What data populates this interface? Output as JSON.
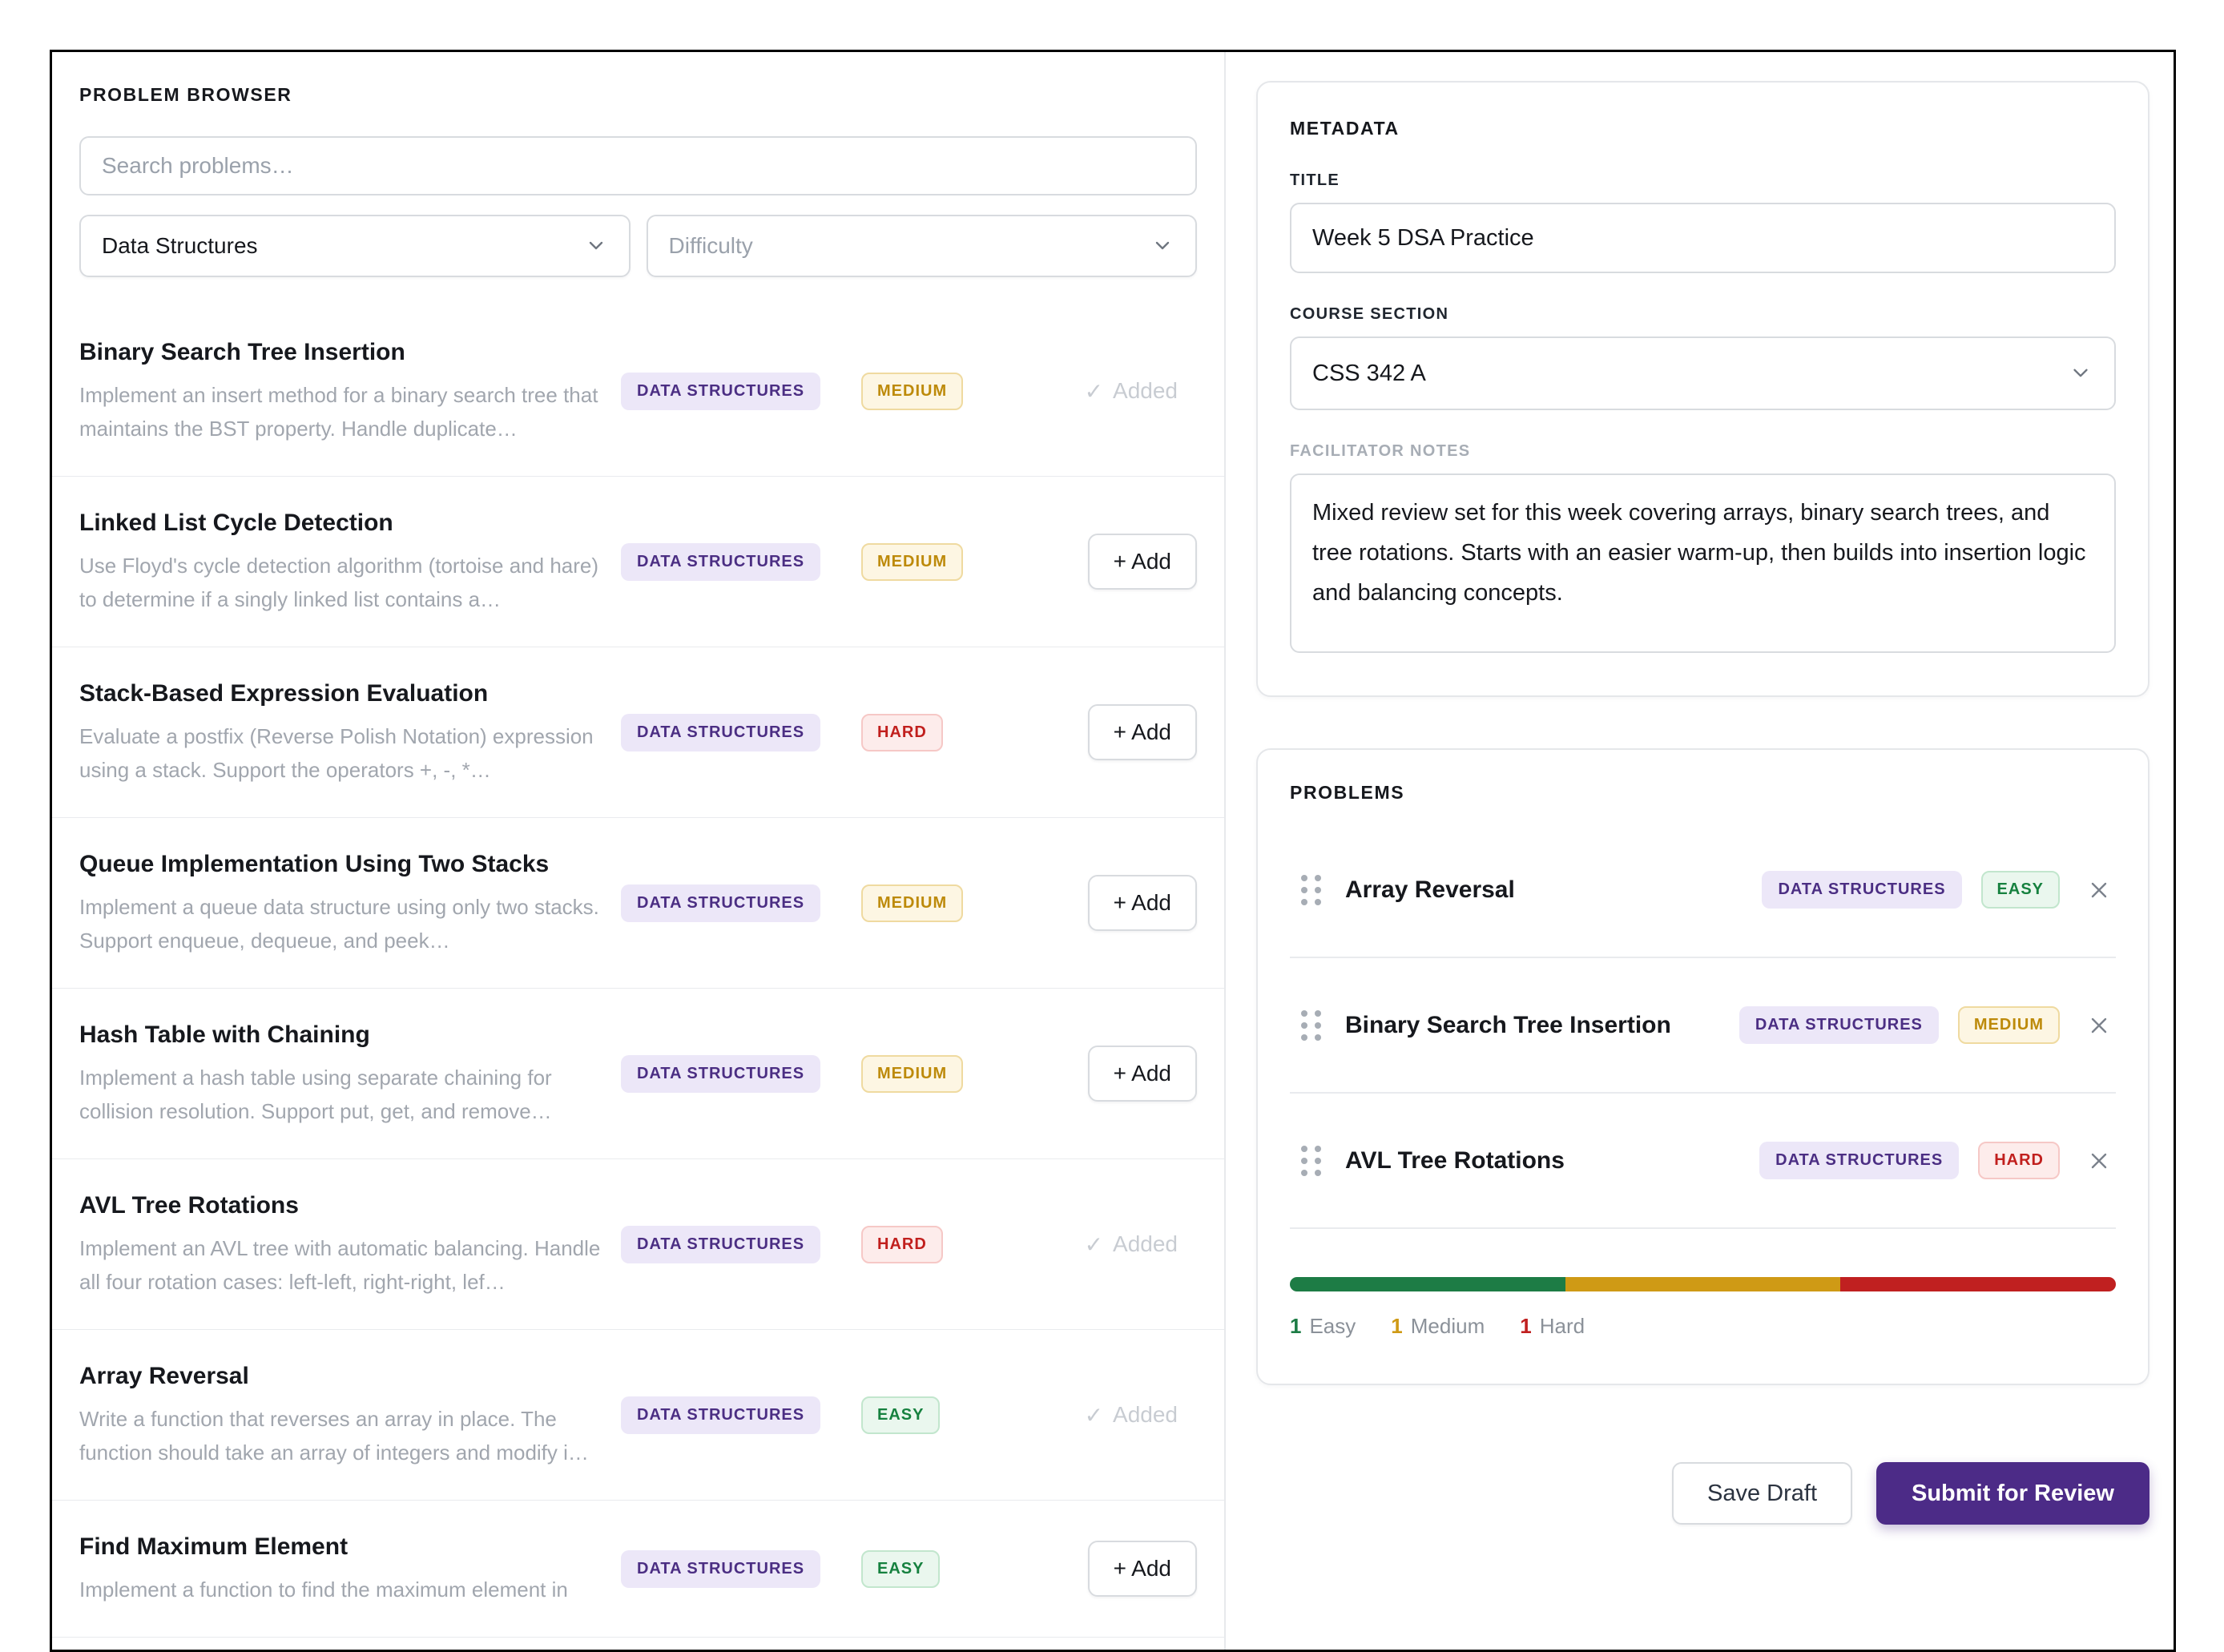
{
  "colors": {
    "accent_purple": "#4b2e83",
    "easy_green": "#1d7c45",
    "medium_amber": "#cf9a15",
    "hard_red": "#c02020"
  },
  "browser": {
    "header": "PROBLEM BROWSER",
    "search_placeholder": "Search problems…",
    "category_filter_value": "Data Structures",
    "difficulty_filter_placeholder": "Difficulty",
    "added_label": "Added",
    "added_check": "✓",
    "add_label": "+ Add",
    "problems": [
      {
        "title": "Binary Search Tree Insertion",
        "description": "Implement an insert method for a binary search tree that maintains the BST property. Handle duplicate…",
        "category": "DATA STRUCTURES",
        "difficulty": "MEDIUM",
        "difficulty_level": "medium",
        "added": true
      },
      {
        "title": "Linked List Cycle Detection",
        "description": "Use Floyd's cycle detection algorithm (tortoise and hare) to determine if a singly linked list contains a…",
        "category": "DATA STRUCTURES",
        "difficulty": "MEDIUM",
        "difficulty_level": "medium",
        "added": false
      },
      {
        "title": "Stack-Based Expression Evaluation",
        "description": "Evaluate a postfix (Reverse Polish Notation) expression using a stack. Support the operators +, -, *…",
        "category": "DATA STRUCTURES",
        "difficulty": "HARD",
        "difficulty_level": "hard",
        "added": false
      },
      {
        "title": "Queue Implementation Using Two Stacks",
        "description": "Implement a queue data structure using only two stacks. Support enqueue, dequeue, and peek…",
        "category": "DATA STRUCTURES",
        "difficulty": "MEDIUM",
        "difficulty_level": "medium",
        "added": false
      },
      {
        "title": "Hash Table with Chaining",
        "description": "Implement a hash table using separate chaining for collision resolution. Support put, get, and remove…",
        "category": "DATA STRUCTURES",
        "difficulty": "MEDIUM",
        "difficulty_level": "medium",
        "added": false
      },
      {
        "title": "AVL Tree Rotations",
        "description": "Implement an AVL tree with automatic balancing. Handle all four rotation cases: left-left, right-right, lef…",
        "category": "DATA STRUCTURES",
        "difficulty": "HARD",
        "difficulty_level": "hard",
        "added": true
      },
      {
        "title": "Array Reversal",
        "description": "Write a function that reverses an array in place. The function should take an array of integers and modify i…",
        "category": "DATA STRUCTURES",
        "difficulty": "EASY",
        "difficulty_level": "easy",
        "added": true
      },
      {
        "title": "Find Maximum Element",
        "description": "Implement a function to find the maximum element in",
        "category": "DATA STRUCTURES",
        "difficulty": "EASY",
        "difficulty_level": "easy",
        "added": false
      }
    ]
  },
  "metadata": {
    "header": "METADATA",
    "title_label": "TITLE",
    "title_value": "Week 5 DSA Practice",
    "course_label": "COURSE SECTION",
    "course_value": "CSS 342 A",
    "notes_label": "FACILITATOR NOTES",
    "notes_value": "Mixed review set for this week covering arrays, binary search trees, and tree rotations. Starts with an easier warm-up, then builds into insertion logic and balancing concepts."
  },
  "selected": {
    "header": "PROBLEMS",
    "items": [
      {
        "title": "Array Reversal",
        "category": "DATA STRUCTURES",
        "difficulty": "EASY",
        "difficulty_level": "easy"
      },
      {
        "title": "Binary Search Tree Insertion",
        "category": "DATA STRUCTURES",
        "difficulty": "MEDIUM",
        "difficulty_level": "medium"
      },
      {
        "title": "AVL Tree Rotations",
        "category": "DATA STRUCTURES",
        "difficulty": "HARD",
        "difficulty_level": "hard"
      }
    ],
    "distribution": [
      {
        "label": "Easy",
        "count": 1,
        "color": "#1d7c45"
      },
      {
        "label": "Medium",
        "count": 1,
        "color": "#cf9a15"
      },
      {
        "label": "Hard",
        "count": 1,
        "color": "#c02020"
      }
    ]
  },
  "footer": {
    "save_label": "Save Draft",
    "submit_label": "Submit for Review"
  }
}
